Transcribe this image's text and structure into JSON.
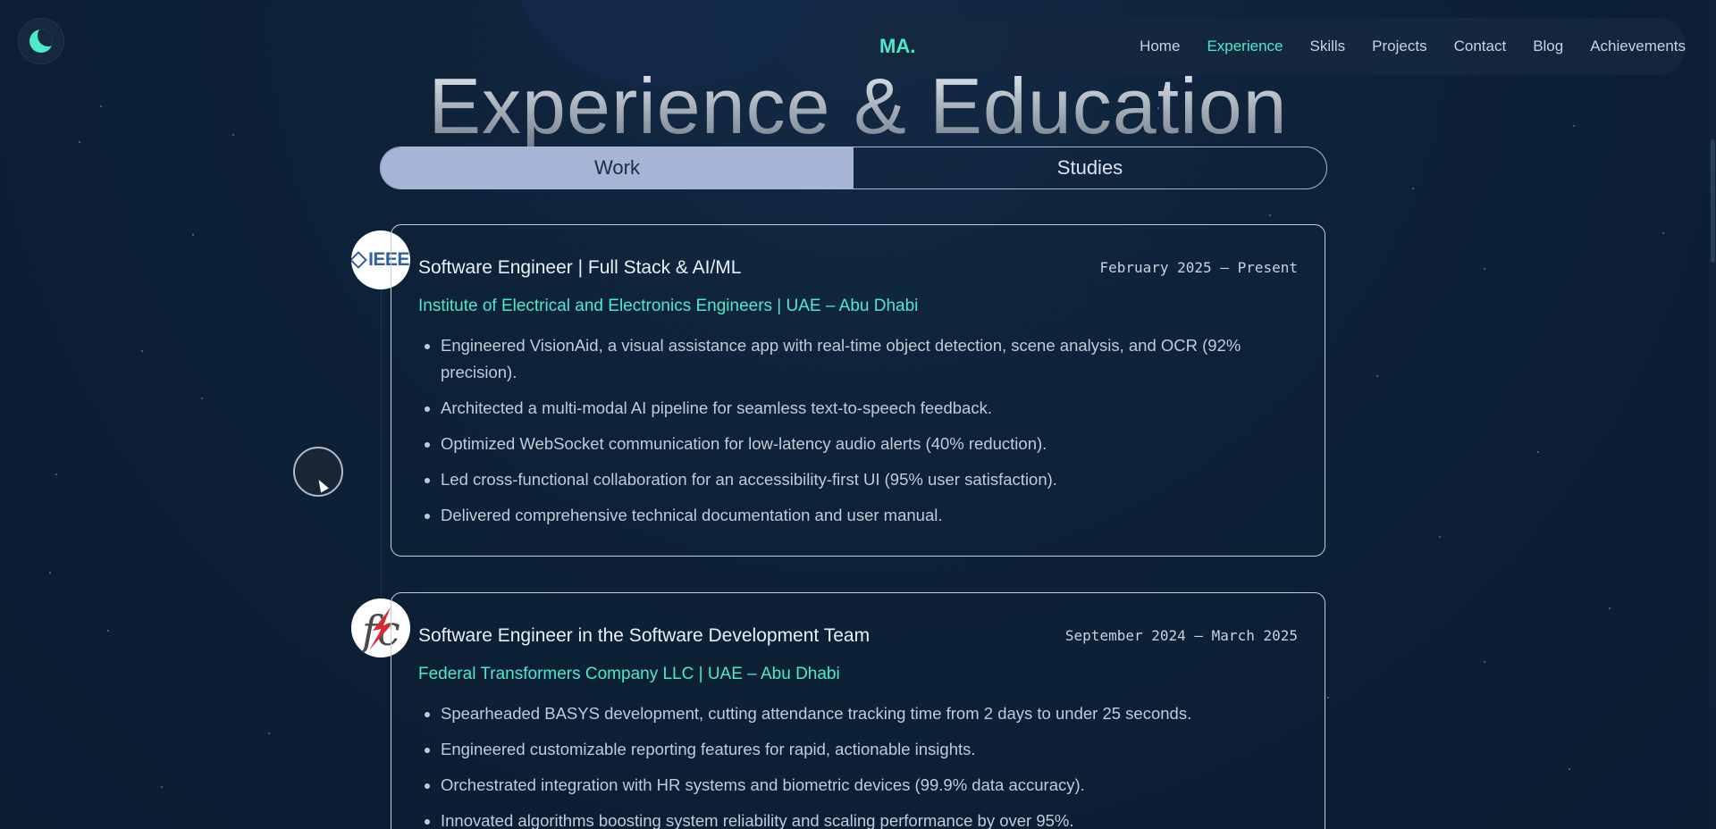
{
  "theme_toggle": {
    "icon": "moon-icon"
  },
  "nav": {
    "logo": "MA.",
    "links": [
      "Home",
      "Experience",
      "Skills",
      "Projects",
      "Contact",
      "Blog",
      "Achievements"
    ],
    "active": "Experience"
  },
  "page": {
    "title": "Experience & Education"
  },
  "tabs": {
    "work": "Work",
    "studies": "Studies",
    "active": "Work"
  },
  "experience": [
    {
      "logo": "IEEE",
      "title": "Software Engineer | Full Stack & AI/ML",
      "date": "February 2025 – Present",
      "company": "Institute of Electrical and Electronics Engineers | UAE – Abu Dhabi",
      "bullets": [
        "Engineered VisionAid, a visual assistance app with real-time object detection, scene analysis, and OCR (92% precision).",
        "Architected a multi-modal AI pipeline for seamless text-to-speech feedback.",
        "Optimized WebSocket communication for low-latency audio alerts (40% reduction).",
        "Led cross-functional collaboration for an accessibility-first UI (95% user satisfaction).",
        "Delivered comprehensive technical documentation and user manual."
      ]
    },
    {
      "logo": "fc",
      "title": "Software Engineer in the Software Development Team",
      "date": "September 2024 – March 2025",
      "company": "Federal Transformers Company LLC | UAE – Abu Dhabi",
      "bullets": [
        "Spearheaded BASYS development, cutting attendance tracking time from 2 days to under 25 seconds.",
        "Engineered customizable reporting features for rapid, actionable insights.",
        "Orchestrated integration with HR systems and biometric devices (99.9% data accuracy).",
        "Innovated algorithms boosting system reliability and scaling performance by over 95%."
      ]
    }
  ],
  "colors": {
    "accent": "#4eeac8",
    "background": "#0d2138",
    "tab_active": "#a7b4d6"
  }
}
